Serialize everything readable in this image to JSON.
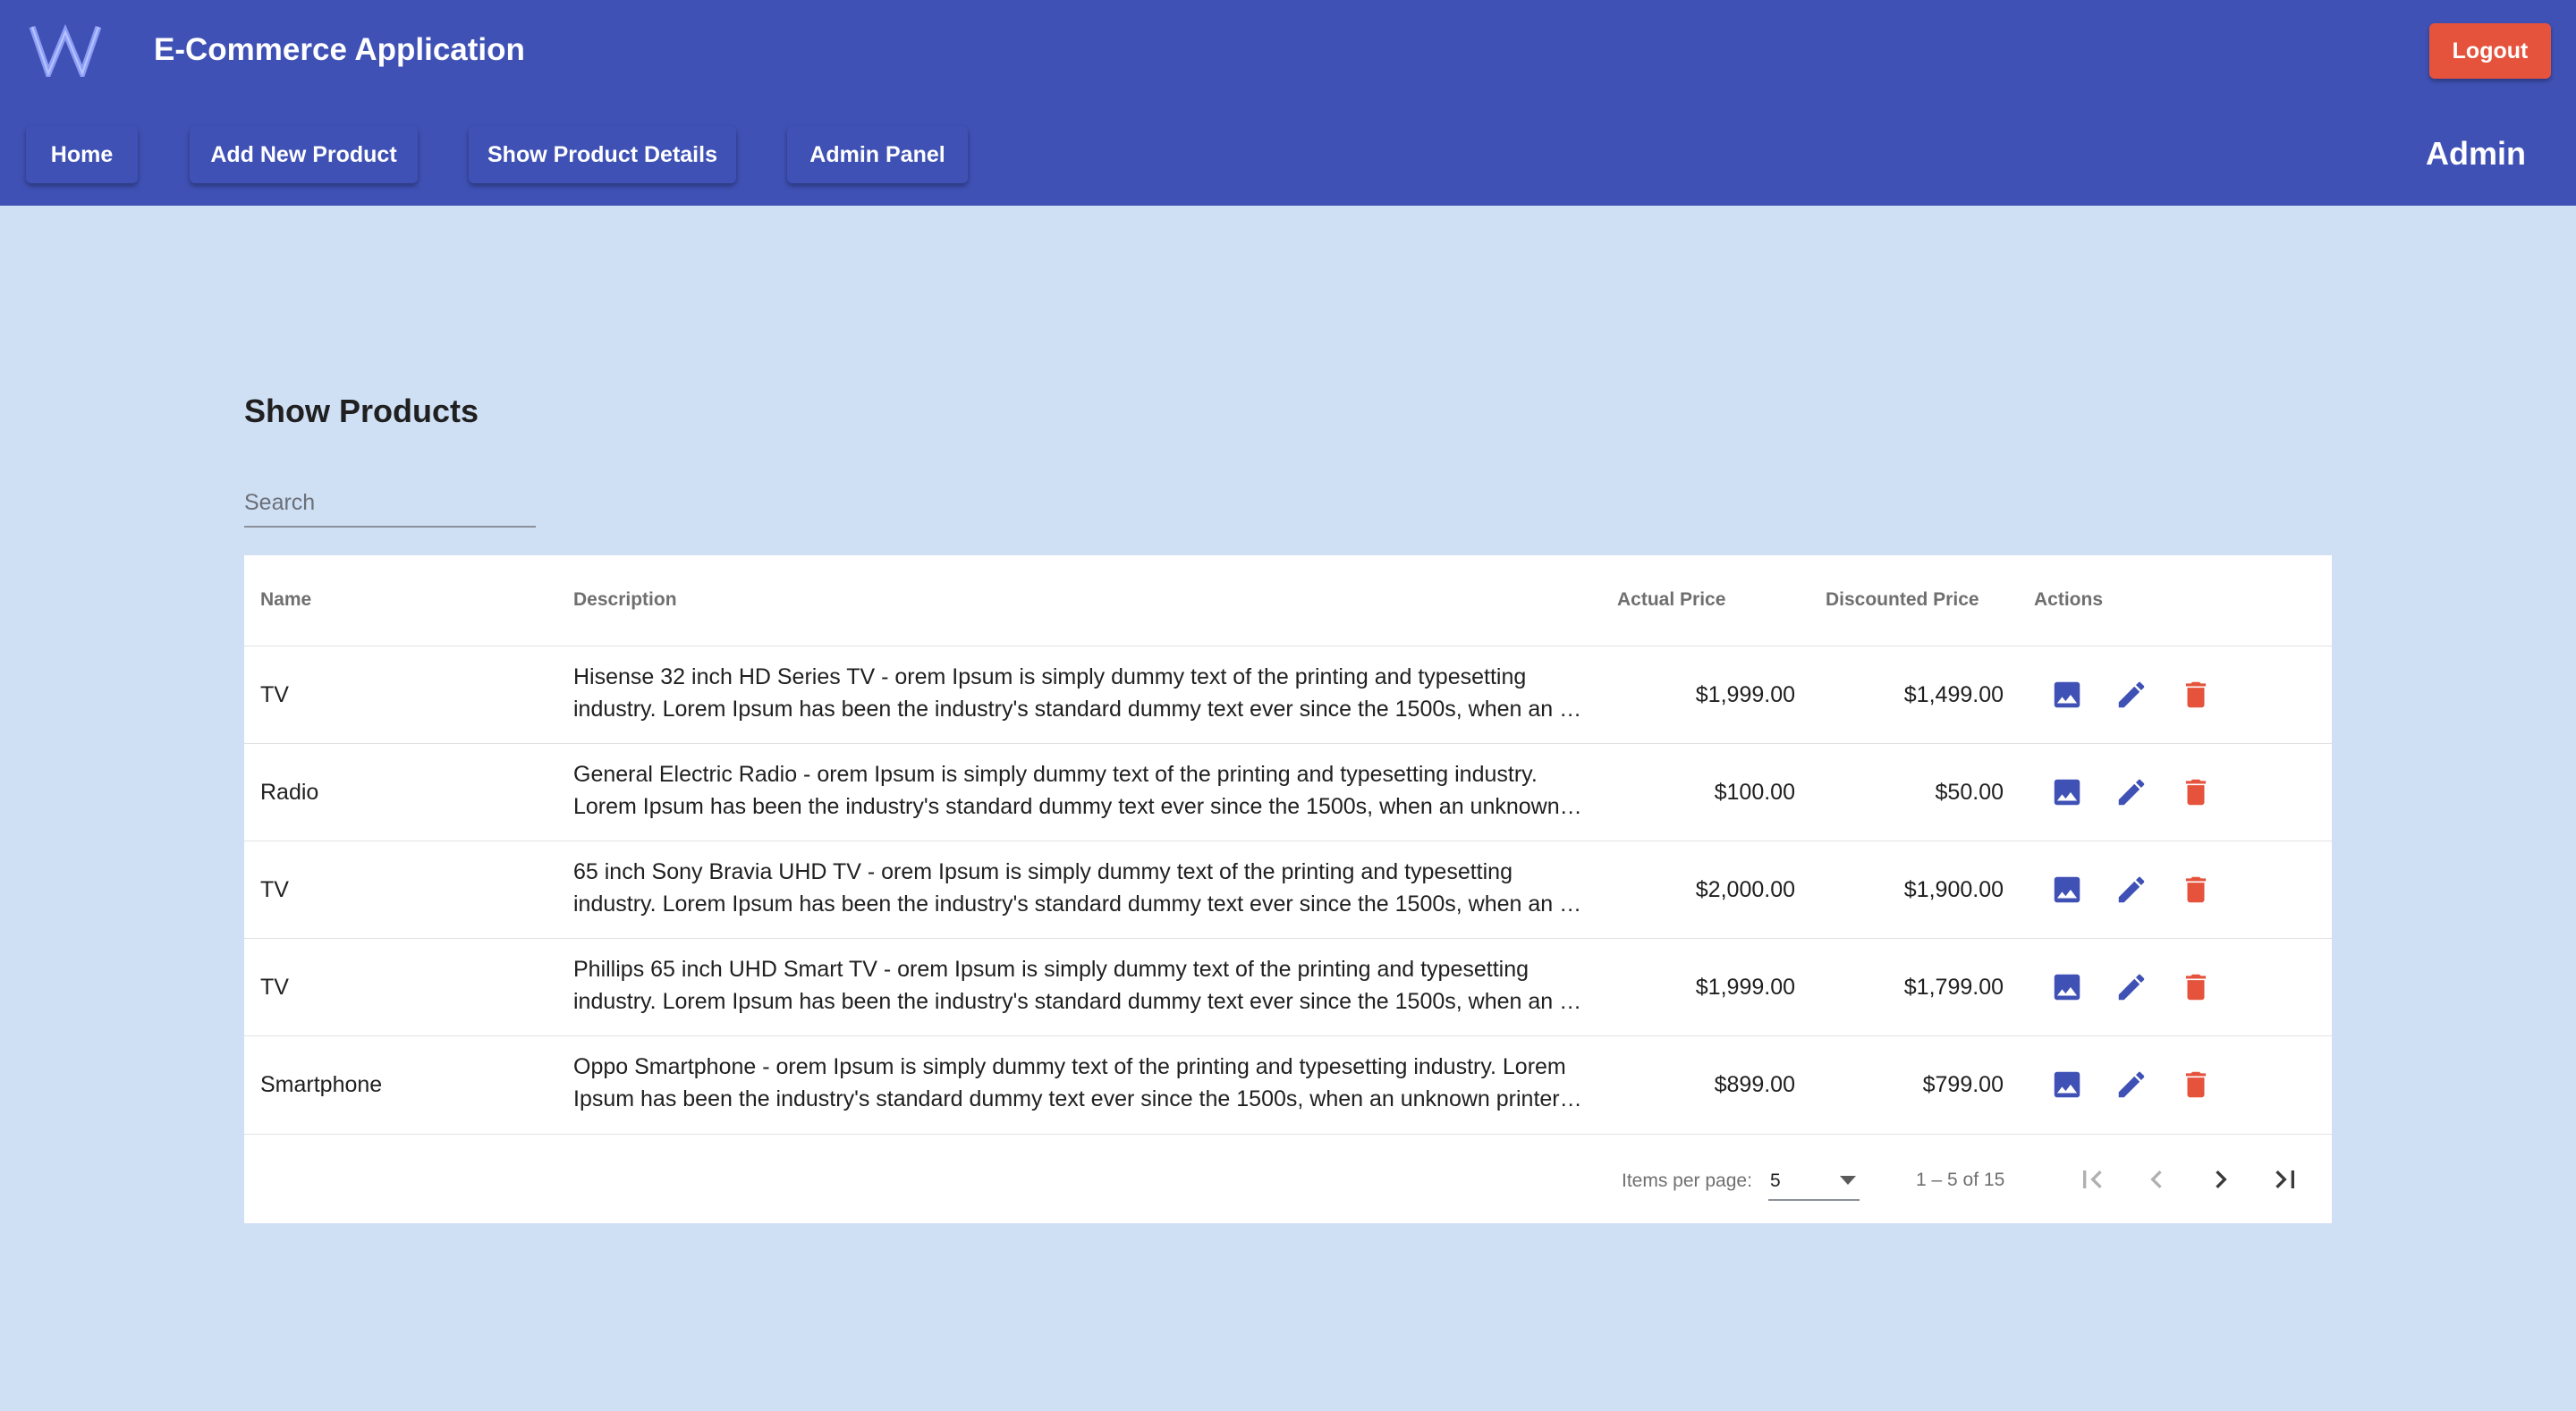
{
  "header": {
    "logo_text": "W",
    "app_title": "E-Commerce Application",
    "logout_label": "Logout",
    "nav": [
      {
        "label": "Home"
      },
      {
        "label": "Add New Product"
      },
      {
        "label": "Show Product Details"
      },
      {
        "label": "Admin Panel"
      }
    ],
    "role_label": "Admin"
  },
  "page": {
    "title": "Show Products",
    "search": {
      "placeholder": "Search",
      "value": ""
    }
  },
  "table": {
    "columns": [
      "Name",
      "Description",
      "Actual Price",
      "Discounted Price",
      "Actions"
    ],
    "rows": [
      {
        "name": "TV",
        "desc_line1": "Hisense 32 inch HD Series TV - orem Ipsum is simply dummy text of the printing and typesetting",
        "desc_line2": "industry. Lorem Ipsum has been the industry's standard dummy text ever since the 1500s, when an unknown printer took a galley",
        "actual": "$1,999.00",
        "discounted": "$1,499.00"
      },
      {
        "name": "Radio",
        "desc_line1": "General Electric Radio - orem Ipsum is simply dummy text of the printing and typesetting industry.",
        "desc_line2": "Lorem Ipsum has been the industry's standard dummy text ever since the 1500s, when an unknown printer took a galley",
        "actual": "$100.00",
        "discounted": "$50.00"
      },
      {
        "name": "TV",
        "desc_line1": "65 inch Sony Bravia UHD TV - orem Ipsum is simply dummy text of the printing and typesetting",
        "desc_line2": "industry. Lorem Ipsum has been the industry's standard dummy text ever since the 1500s, when an unknown printer took a galley",
        "actual": "$2,000.00",
        "discounted": "$1,900.00"
      },
      {
        "name": "TV",
        "desc_line1": "Phillips 65 inch UHD Smart TV - orem Ipsum is simply dummy text of the printing and typesetting",
        "desc_line2": "industry. Lorem Ipsum has been the industry's standard dummy text ever since the 1500s, when an unknown printer took a galley",
        "actual": "$1,999.00",
        "discounted": "$1,799.00"
      },
      {
        "name": "Smartphone",
        "desc_line1": "Oppo Smartphone - orem Ipsum is simply dummy text of the printing and typesetting industry. Lorem",
        "desc_line2": "Ipsum has been the industry's standard dummy text ever since the 1500s, when an unknown printer took a galley",
        "actual": "$899.00",
        "discounted": "$799.00"
      }
    ],
    "action_icons": [
      "image-icon",
      "edit-icon",
      "delete-icon"
    ]
  },
  "paginator": {
    "items_per_page_label": "Items per page:",
    "items_per_page_value": "5",
    "range_label": "1 – 5 of 15",
    "icons": [
      "first-page-icon",
      "previous-page-icon",
      "next-page-icon",
      "last-page-icon"
    ]
  },
  "colors": {
    "header_bg": "#3f51b5",
    "page_bg": "#cfe0f5",
    "logout_bg": "#e5533d",
    "icon_blue": "#3f51b5",
    "icon_red": "#e5533d"
  }
}
